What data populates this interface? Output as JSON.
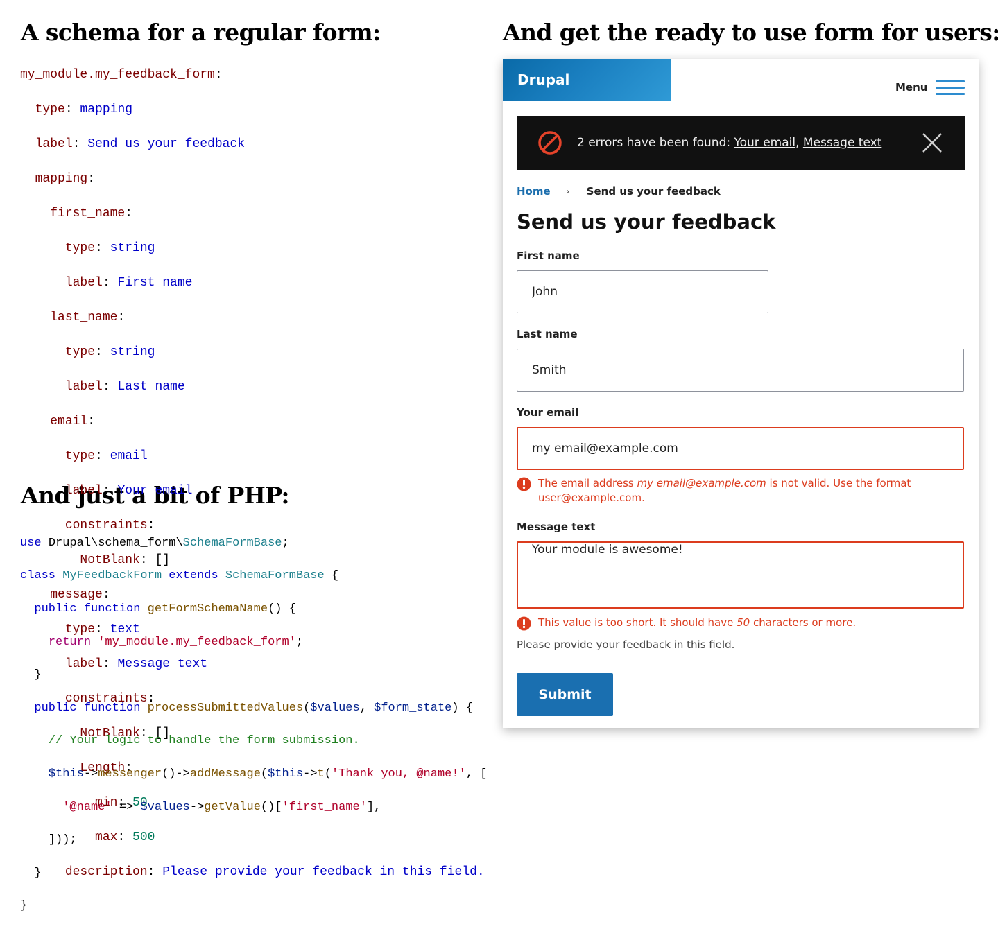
{
  "headings": {
    "schema": "A schema for a regular form:",
    "form": "And get the ready to use  form for users:",
    "php": "And just a bit of  PHP:"
  },
  "yaml": {
    "root": "my_module.my_feedback_form",
    "type_key": "type",
    "type_val": "mapping",
    "label_key": "label",
    "label_val": "Send us your feedback",
    "mapping_key": "mapping",
    "first_name": {
      "key": "first_name",
      "type": "string",
      "label": "First name"
    },
    "last_name": {
      "key": "last_name",
      "type": "string",
      "label": "Last name"
    },
    "email": {
      "key": "email",
      "type": "email",
      "label": "Your email",
      "constraints_key": "constraints",
      "notblank": "NotBlank",
      "empty": "[]"
    },
    "message": {
      "key": "message",
      "type": "text",
      "label": "Message text",
      "constraints_key": "constraints",
      "notblank": "NotBlank",
      "empty": "[]",
      "length": "Length",
      "min_key": "min",
      "min_val": "50",
      "max_key": "max",
      "max_val": "500",
      "description_key": "description",
      "description_val": "Please provide your feedback in this field."
    }
  },
  "php": {
    "use_kw": "use",
    "namespace": "Drupal\\schema_form\\",
    "base_class": "SchemaFormBase",
    "class_kw": "class",
    "class_name": "MyFeedbackForm",
    "extends_kw": "extends",
    "public_kw": "public",
    "function_kw": "function",
    "fn1": "getFormSchemaName",
    "return_kw": "return",
    "schema_str": "'my_module.my_feedback_form'",
    "fn2": "processSubmittedValues",
    "arg1": "$values",
    "arg2": "$form_state",
    "comment": "// Your logic to handle the form submission.",
    "this": "$this",
    "messenger": "messenger",
    "add_message": "addMessage",
    "t": "t",
    "thank_str": "'Thank you, @name!'",
    "name_key": "'@name'",
    "get_value": "getValue",
    "first_name_key": "'first_name'"
  },
  "form": {
    "brand": "Drupal",
    "menu_label": "Menu",
    "errors": {
      "prefix": "2 errors have been found: ",
      "link1": "Your email",
      "sep": ", ",
      "link2": "Message text"
    },
    "breadcrumb": {
      "home": "Home",
      "current": "Send us your feedback"
    },
    "title": "Send us your feedback",
    "first_name": {
      "label": "First name",
      "value": "John"
    },
    "last_name": {
      "label": "Last name",
      "value": "Smith"
    },
    "email": {
      "label": "Your email",
      "value": "my email@example.com",
      "error_pre": "The email address ",
      "error_em": "my email@example.com",
      "error_post": " is not valid. Use the format user@example.com."
    },
    "message": {
      "label": "Message text",
      "value": "Your module is awesome!",
      "error_pre": "This value is too short. It should have ",
      "error_em": "50",
      "error_post": " characters or more.",
      "description": "Please provide your feedback in this field."
    },
    "submit": "Submit",
    "colors": {
      "brand": "#1a7fc0",
      "error": "#dc3c1e",
      "button": "#1a6fb0",
      "alert_bg": "#111111"
    }
  }
}
